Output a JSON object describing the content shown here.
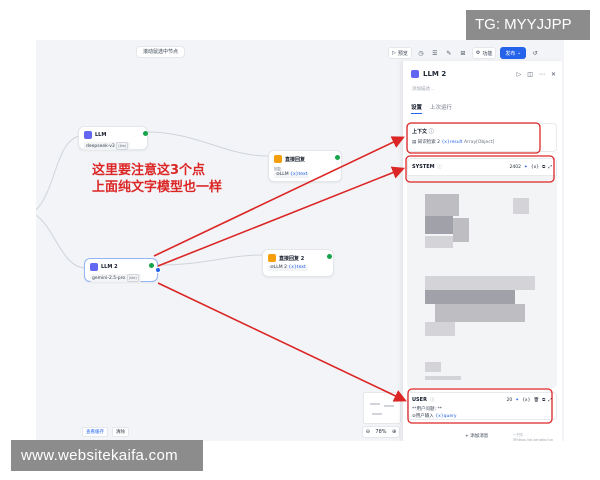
{
  "watermark_top": "TG: MYYJJPP",
  "watermark_bottom": "www.websitekaifa.com",
  "canvas": {
    "hint": "滚动鼠选中节点",
    "toolbar": {
      "preview": "预览",
      "features": "功能",
      "publish": "发布"
    },
    "bottom": {
      "debug": "查看缓存",
      "clear": "清除"
    },
    "zoom": "78%"
  },
  "nodes": {
    "llm1": {
      "title": "LLM",
      "model": "deepseek-v3",
      "tag": "(lite)"
    },
    "reply1": {
      "title": "直接回复",
      "sub": "回复",
      "ref": "LLM",
      "var": "{x}text"
    },
    "llm2": {
      "title": "LLM 2",
      "model": "gemini-2.5-pro",
      "tag": "(lite)"
    },
    "reply2": {
      "title": "直接回复 2",
      "ref": "LLM 2",
      "var": "{x}text"
    }
  },
  "annotation": {
    "line1": "这里要注意这3个点",
    "line2": "上面纯文字模型也一样"
  },
  "panel": {
    "title": "LLM 2",
    "desc": "添加描述...",
    "tabs": [
      "设置",
      "上次运行"
    ],
    "context": {
      "label": "上下文",
      "source": "知识检索 2",
      "var": "{x}result",
      "type": "Array[Object]"
    },
    "system": {
      "label": "SYSTEM",
      "count": "2402"
    },
    "user": {
      "label": "USER",
      "count": "20",
      "line1": "**用户问题: **",
      "src": "用户输入",
      "var": "{x}query"
    },
    "add_message": "+ 添加消息",
    "credit": "一只牛@https://ai.xeradio.fun"
  },
  "colors": {
    "accent": "#2563eb",
    "annotation": "#dc2626",
    "node_llm": "#6366f1",
    "node_reply": "#f59e0b"
  }
}
